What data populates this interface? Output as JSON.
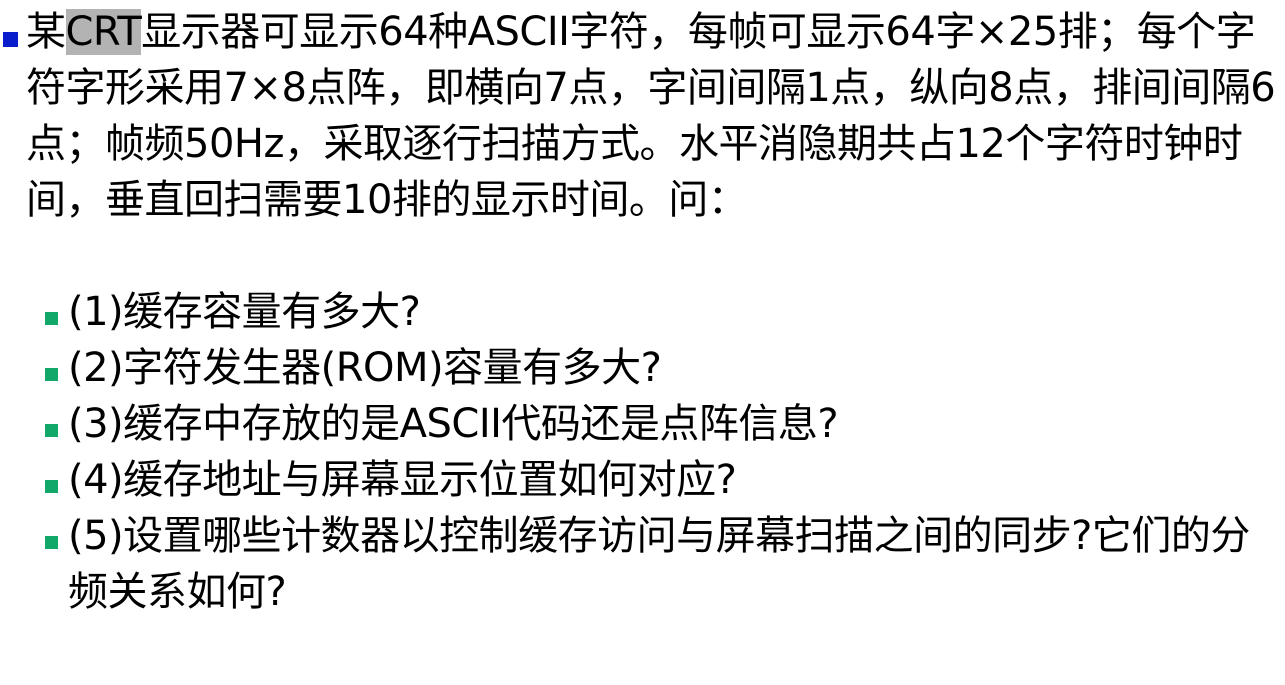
{
  "main": {
    "text_before": "某",
    "highlighted": "CRT",
    "text_after": "显示器可显示64种ASCII字符，每帧可显示64字×25排；每个字符字形采用7×8点阵，即横向7点，字间间隔1点，纵向8点，排间间隔6点；帧频50Hz，采取逐行扫描方式。水平消隐期共占12个字符时钟时间，垂直回扫需要10排的显示时间。问："
  },
  "questions": [
    {
      "text": "(1)缓存容量有多大?"
    },
    {
      "text": "(2)字符发生器(ROM)容量有多大?"
    },
    {
      "text": "(3)缓存中存放的是ASCII代码还是点阵信息?"
    },
    {
      "text": "(4)缓存地址与屏幕显示位置如何对应?"
    },
    {
      "text": "(5)设置哪些计数器以控制缓存访问与屏幕扫描之间的同步?它们的分频关系如何?"
    }
  ],
  "colors": {
    "main_bullet": "#0a1dcc",
    "sub_bullet": "#12a86a",
    "highlight": "#b3b3b3"
  }
}
